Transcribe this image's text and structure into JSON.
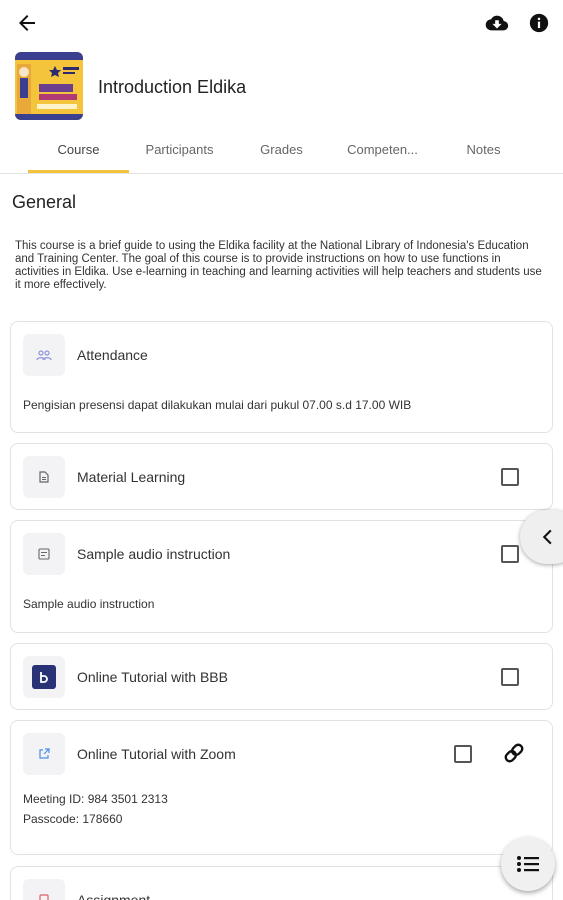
{
  "course": {
    "title": "Introduction Eldika"
  },
  "tabs": [
    {
      "label": "Course"
    },
    {
      "label": "Participants"
    },
    {
      "label": "Grades"
    },
    {
      "label": "Competen..."
    },
    {
      "label": "Notes"
    }
  ],
  "section": {
    "title": "General",
    "summary": "This course is a brief guide to using the Eldika facility at the National Library of Indonesia's Education and Training Center. The goal of this course is to provide instructions on how to use functions in activities in Eldika. Use e-learning in teaching and learning activities will help teachers and students use it more effectively."
  },
  "modules": [
    {
      "name": "Attendance",
      "icon": "attendance-icon",
      "description": "Pengisian presensi dapat dilakukan mulai dari pukul 07.00 s.d 17.00 WIB"
    },
    {
      "name": "Material Learning",
      "icon": "file-icon"
    },
    {
      "name": "Sample audio instruction",
      "icon": "page-icon",
      "description": "Sample audio instruction"
    },
    {
      "name": "Online Tutorial with BBB",
      "icon": "bigbluebutton-icon"
    },
    {
      "name": "Online Tutorial with Zoom",
      "icon": "external-url-icon",
      "description_lines": [
        "Meeting ID: 984 3501 2313",
        "Passcode: 178660"
      ]
    },
    {
      "name": "Assignment",
      "icon": "assignment-icon"
    }
  ],
  "colors": {
    "accent": "#f5c33b",
    "bbb": "#283274"
  }
}
